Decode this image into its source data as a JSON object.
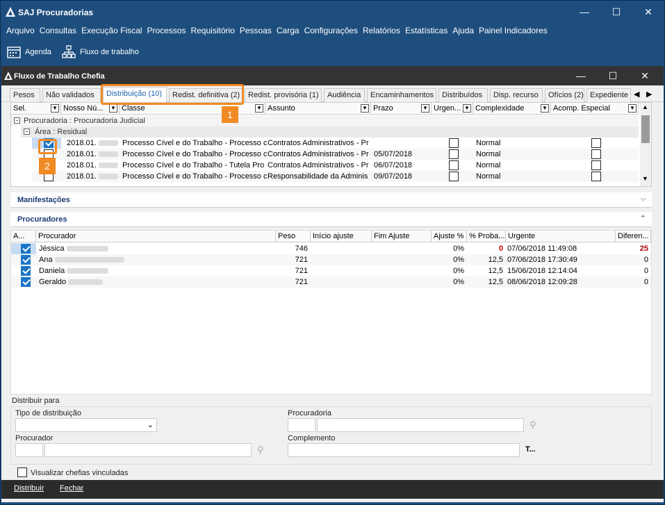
{
  "app": {
    "title": "SAJ Procuradorias"
  },
  "menu": [
    "Arquivo",
    "Consultas",
    "Execução Fiscal",
    "Processos",
    "Requisitório",
    "Pessoas",
    "Carga",
    "Configurações",
    "Relatórios",
    "Estatísticas",
    "Ajuda",
    "Painel Indicadores"
  ],
  "toolbar": {
    "agenda": "Agenda",
    "fluxo": "Fluxo de trabalho"
  },
  "dialog": {
    "title": "Fluxo de Trabalho Chefia"
  },
  "tabs": [
    "Pesos",
    "Não validados",
    "Distribuição (10)",
    "Redist. definitiva (2)",
    "Redist. provisória (1)",
    "Audiência",
    "Encaminhamentos",
    "Distribuídos",
    "Disp. recurso",
    "Ofícios (2)",
    "Expediente"
  ],
  "grid": {
    "headers": [
      "Sel.",
      "Nosso Nú...",
      "Classe",
      "Assunto",
      "Prazo",
      "Urgen...",
      "Complexidade",
      "Acomp. Especial"
    ],
    "group1": "Procuradoria : Procuradoria Judicial",
    "group2": "Área : Residual",
    "rows": [
      {
        "checked": true,
        "num": "2018.01.",
        "classe": "Processo Cível e do Trabalho - Processo c",
        "assunto": "Contratos Administrativos - Pr",
        "prazo": "",
        "complexidade": "Normal"
      },
      {
        "checked": false,
        "num": "2018.01.",
        "classe": "Processo Cível e do Trabalho - Processo c",
        "assunto": "Contratos Administrativos - Pr",
        "prazo": "05/07/2018",
        "complexidade": "Normal"
      },
      {
        "checked": false,
        "num": "2018.01.",
        "classe": "Processo Cível e do Trabalho - Tutela Pro",
        "assunto": "Contratos Administrativos - Pr",
        "prazo": "06/07/2018",
        "complexidade": "Normal"
      },
      {
        "checked": false,
        "num": "2018.01.",
        "classe": "Processo Cível e do Trabalho - Processo c",
        "assunto": "Responsabilidade da Adminis",
        "prazo": "09/07/2018",
        "complexidade": "Normal"
      }
    ]
  },
  "sections": {
    "manifestacoes": "Manifestações",
    "procuradores": "Procuradores"
  },
  "procs": {
    "headers": [
      "A...",
      "Procurador",
      "Peso",
      "Início ajuste",
      "Fim Ajuste",
      "Ajuste %",
      "% Proba...",
      "Urgente",
      "Diferen..."
    ],
    "rows": [
      {
        "name": "Jéssica",
        "peso": "746",
        "ajuste": "0%",
        "prob": "0",
        "urgente": "07/06/2018 11:49:08",
        "dif": "25"
      },
      {
        "name": "Ana",
        "peso": "721",
        "ajuste": "0%",
        "prob": "12,5",
        "urgente": "07/06/2018 17:30:49",
        "dif": "0"
      },
      {
        "name": "Daniela",
        "peso": "721",
        "ajuste": "0%",
        "prob": "12,5",
        "urgente": "15/06/2018 12:14:04",
        "dif": "0"
      },
      {
        "name": "Geraldo",
        "peso": "721",
        "ajuste": "0%",
        "prob": "12,5",
        "urgente": "08/06/2018 12:09:28",
        "dif": "0"
      }
    ]
  },
  "form": {
    "title": "Distribuir para",
    "tipo": "Tipo de distribuição",
    "procuradoria": "Procuradoria",
    "procurador": "Procurador",
    "complemento": "Complemento",
    "complemento_btn": "T..."
  },
  "footer": {
    "visualizar": "Visualizar chefias vinculadas",
    "distribuir": "Distribuir",
    "fechar": "Fechar"
  },
  "callouts": {
    "one": "1",
    "two": "2"
  }
}
